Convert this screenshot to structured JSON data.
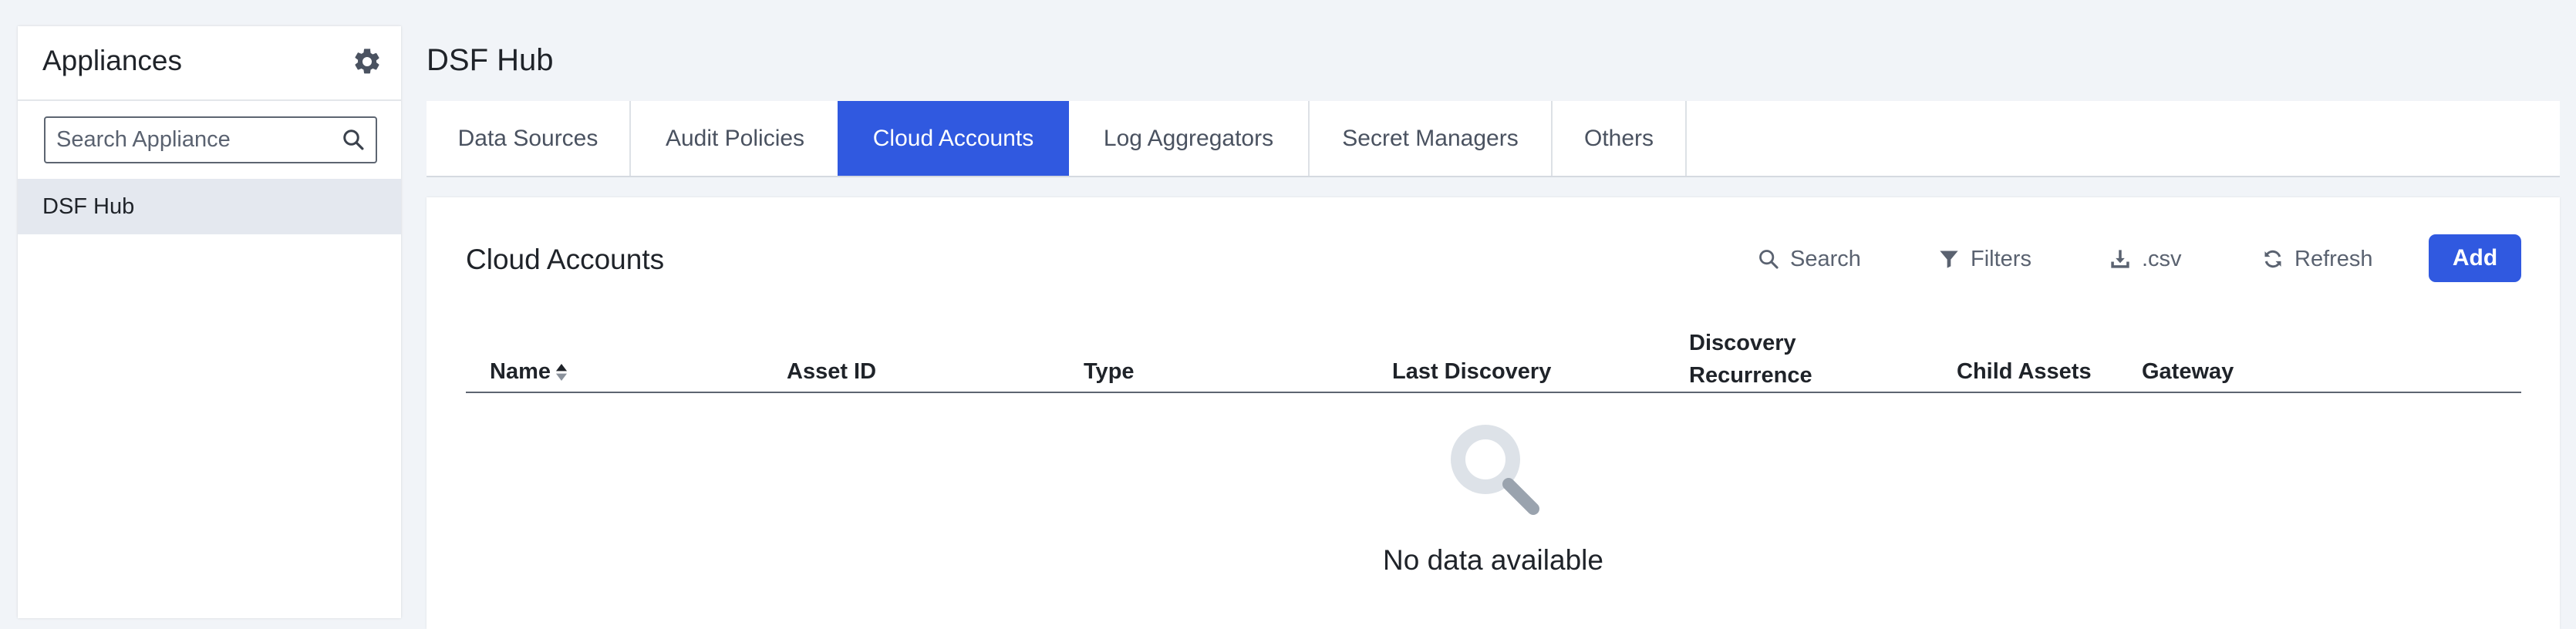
{
  "sidebar": {
    "title": "Appliances",
    "search_placeholder": "Search Appliance",
    "items": [
      {
        "label": "DSF Hub"
      }
    ]
  },
  "page": {
    "title": "DSF Hub"
  },
  "tabs": [
    {
      "label": "Data Sources",
      "active": false
    },
    {
      "label": "Audit Policies",
      "active": false
    },
    {
      "label": "Cloud Accounts",
      "active": true
    },
    {
      "label": "Log Aggregators",
      "active": false
    },
    {
      "label": "Secret Managers",
      "active": false
    },
    {
      "label": "Others",
      "active": false
    }
  ],
  "panel": {
    "title": "Cloud Accounts",
    "toolbar": {
      "search_label": "Search",
      "filters_label": "Filters",
      "csv_label": ".csv",
      "refresh_label": "Refresh",
      "add_label": "Add"
    },
    "columns": {
      "name": "Name",
      "asset_id": "Asset ID",
      "type": "Type",
      "last_discovery": "Last Discovery",
      "discovery_recurrence_1": "Discovery",
      "discovery_recurrence_2": "Recurrence",
      "child_assets": "Child Assets",
      "gateway": "Gateway"
    },
    "empty_text": "No data available"
  },
  "colors": {
    "accent": "#3059e0",
    "background": "#f1f4f8",
    "sidebar_selected": "#e4e8ef",
    "muted_text": "#5a6270"
  },
  "icons": {
    "gear": "gear-icon",
    "search": "search-icon",
    "filter": "filter-icon",
    "download": "download-icon",
    "refresh": "refresh-icon",
    "sort": "sort-icon",
    "empty": "magnifier-empty-icon"
  }
}
